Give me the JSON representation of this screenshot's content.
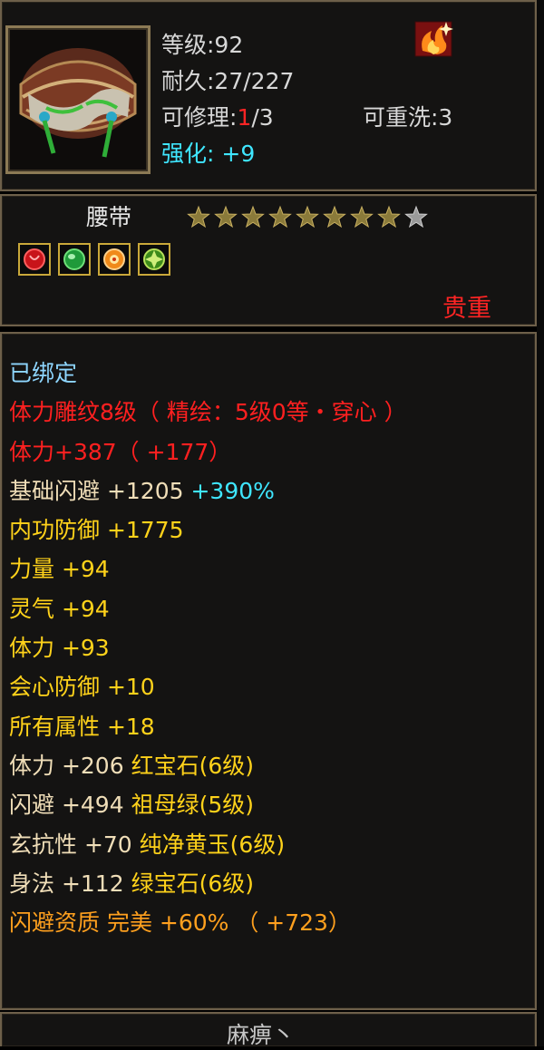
{
  "header": {
    "level_label": "等级:92",
    "durability_label": "耐久:27/227",
    "repair_label": "可修理:",
    "repair_current": "1",
    "repair_total": "/3",
    "rewash_label": "可重洗:3",
    "enhance_label": "强化:",
    "enhance_value": "+9"
  },
  "item": {
    "name": "腰带",
    "stars_filled": 8,
    "stars_total": 9,
    "quality": "贵重",
    "gem_icons": [
      "red-gem-icon",
      "green-jade-icon",
      "orange-gem-icon",
      "green-gem-icon"
    ]
  },
  "lines": [
    {
      "parts": [
        {
          "text": "已绑定",
          "cls": "c-bound"
        }
      ]
    },
    {
      "parts": [
        {
          "text": "体力雕纹8级（ 精绘：5级0等・穿心 ）",
          "cls": "c-red"
        }
      ]
    },
    {
      "parts": [
        {
          "text": "体力+387（ +177）",
          "cls": "c-red"
        }
      ]
    },
    {
      "parts": [
        {
          "text": "基础闪避  +1205 ",
          "cls": "c-beige"
        },
        {
          "text": "+390%",
          "cls": "c-cyan"
        }
      ]
    },
    {
      "parts": [
        {
          "text": "内功防御  +1775",
          "cls": "c-yellow"
        }
      ]
    },
    {
      "parts": [
        {
          "text": "力量  +94",
          "cls": "c-yellow"
        }
      ]
    },
    {
      "parts": [
        {
          "text": "灵气  +94",
          "cls": "c-yellow"
        }
      ]
    },
    {
      "parts": [
        {
          "text": "体力  +93",
          "cls": "c-yellow"
        }
      ]
    },
    {
      "parts": [
        {
          "text": "会心防御  +10",
          "cls": "c-yellow"
        }
      ]
    },
    {
      "parts": [
        {
          "text": "所有属性  +18",
          "cls": "c-yellow"
        }
      ]
    },
    {
      "parts": [
        {
          "text": "体力  +206  ",
          "cls": "c-beige"
        },
        {
          "text": "红宝石(6级)",
          "cls": "c-yellow"
        }
      ]
    },
    {
      "parts": [
        {
          "text": "闪避  +494  ",
          "cls": "c-beige"
        },
        {
          "text": "祖母绿(5级)",
          "cls": "c-yellow"
        }
      ]
    },
    {
      "parts": [
        {
          "text": "玄抗性  +70  ",
          "cls": "c-beige"
        },
        {
          "text": "纯净黄玉(6级)",
          "cls": "c-yellow"
        }
      ]
    },
    {
      "parts": [
        {
          "text": "身法  +112  ",
          "cls": "c-beige"
        },
        {
          "text": "绿宝石(6级)",
          "cls": "c-yellow"
        }
      ]
    },
    {
      "parts": [
        {
          "text": "闪避资质   完美  +60% （ +723）",
          "cls": "c-orange"
        }
      ]
    }
  ],
  "footer": {
    "text": "麻痹丶"
  },
  "colors": {
    "border": "#6e604a",
    "red": "#ff2424",
    "cyan": "#3fe6ff",
    "yellow": "#ffd21a",
    "orange": "#ffa01e"
  }
}
